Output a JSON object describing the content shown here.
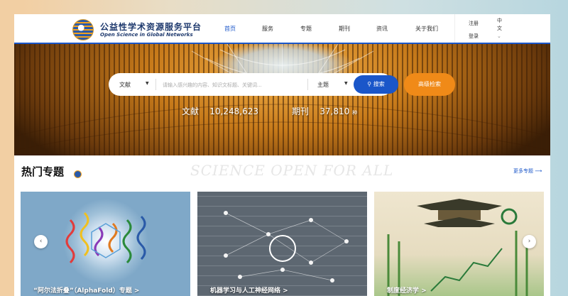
{
  "brand": {
    "name_cn": "公益性学术资源服务平台",
    "name_en": "Open Science in Global Networks"
  },
  "nav": [
    {
      "label": "首页",
      "active": true
    },
    {
      "label": "服务"
    },
    {
      "label": "专题"
    },
    {
      "label": "期刊"
    },
    {
      "label": "资讯"
    },
    {
      "label": "关于我们"
    }
  ],
  "account": {
    "register": "注册",
    "login": "登录",
    "language": "中文"
  },
  "search": {
    "type_select": "文献",
    "placeholder": "请输入感兴趣的内容、知识文标题、关键词...",
    "field_select": "主题",
    "search_button": "搜索",
    "advanced_button": "高级检索"
  },
  "stats": [
    {
      "label": "文献",
      "value": "10,248,623"
    },
    {
      "label": "期刊",
      "value": "37,810",
      "unit": "种"
    }
  ],
  "section": {
    "title": "热门专题",
    "slogan": "SCIENCE OPEN FOR ALL",
    "more": "更多专题 ⟶"
  },
  "cards": [
    {
      "caption": "“阿尔法折叠”（AlphaFold）专题  >"
    },
    {
      "caption": "机器学习与人工神经网络  >"
    },
    {
      "caption": "制度经济学  >"
    }
  ],
  "colors": {
    "primary": "#1a56c9",
    "accent": "#f08a18"
  }
}
